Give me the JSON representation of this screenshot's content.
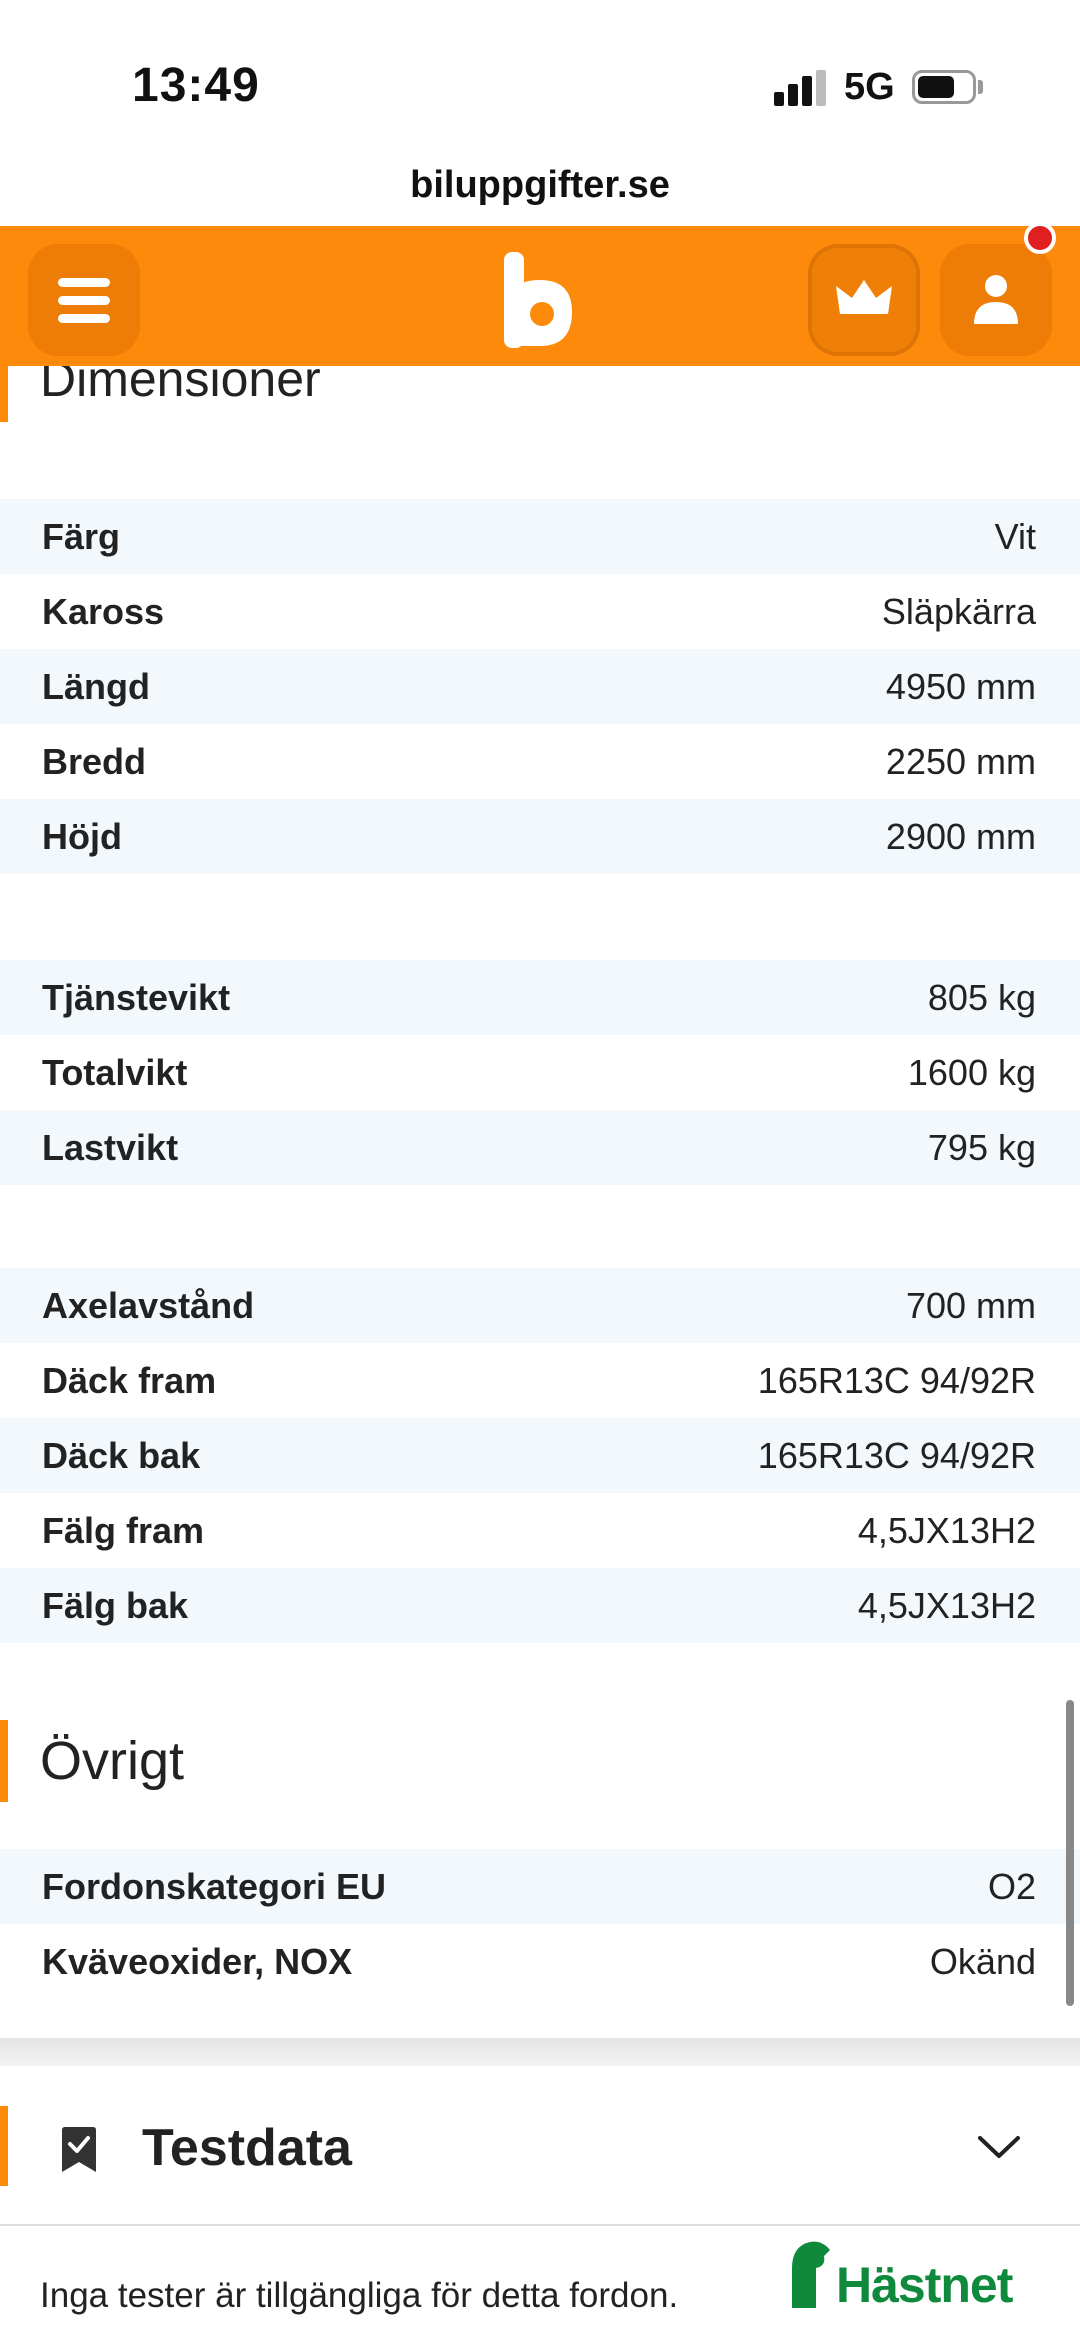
{
  "status_bar": {
    "time": "13:49",
    "network": "5G"
  },
  "browser": {
    "url": "biluppgifter.se"
  },
  "header": {
    "logo": "b"
  },
  "dimensions": {
    "title": "Dimensioner",
    "group1": [
      {
        "label": "Färg",
        "value": "Vit"
      },
      {
        "label": "Kaross",
        "value": "Släpkärra"
      },
      {
        "label": "Längd",
        "value": "4950 mm"
      },
      {
        "label": "Bredd",
        "value": "2250 mm"
      },
      {
        "label": "Höjd",
        "value": "2900 mm"
      }
    ],
    "group2": [
      {
        "label": "Tjänstevikt",
        "value": "805 kg"
      },
      {
        "label": "Totalvikt",
        "value": "1600 kg"
      },
      {
        "label": "Lastvikt",
        "value": "795 kg"
      }
    ],
    "group3": [
      {
        "label": "Axelavstånd",
        "value": "700 mm"
      },
      {
        "label": "Däck fram",
        "value": "165R13C 94/92R"
      },
      {
        "label": "Däck bak",
        "value": "165R13C 94/92R"
      },
      {
        "label": "Fälg fram",
        "value": "4,5JX13H2"
      },
      {
        "label": "Fälg bak",
        "value": "4,5JX13H2"
      }
    ]
  },
  "ovrigt": {
    "title": "Övrigt",
    "rows": [
      {
        "label": "Fordonskategori EU",
        "value": "O2"
      },
      {
        "label": "Kväveoxider, NOX",
        "value": "Okänd"
      }
    ]
  },
  "testdata": {
    "title": "Testdata",
    "message": "Inga tester är tillgängliga för detta fordon.",
    "partner": "Hästnet"
  },
  "colors": {
    "brand": "#fd8a0b",
    "row_alt": "#f2f8fb",
    "partner_green": "#0f8a3c"
  }
}
